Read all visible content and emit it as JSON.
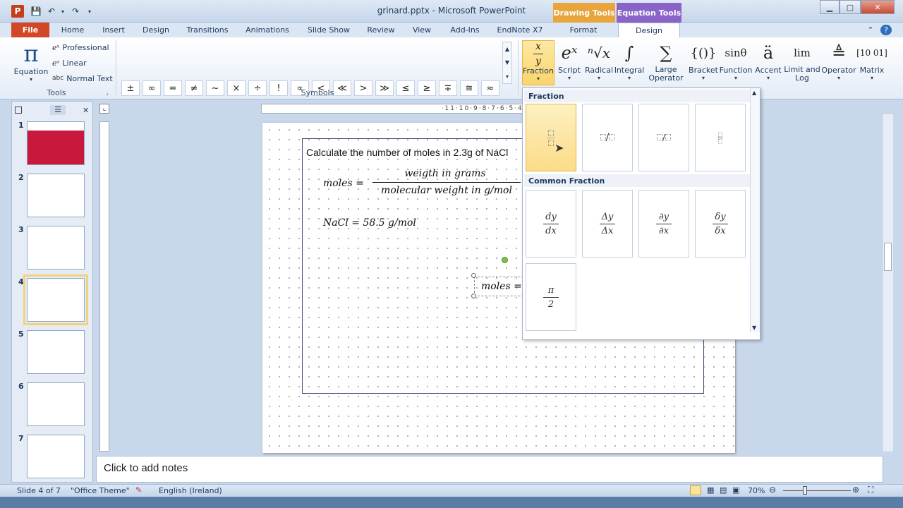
{
  "window": {
    "title": "grinard.pptx - Microsoft PowerPoint",
    "contextual_tabs": [
      "Drawing Tools",
      "Equation Tools"
    ]
  },
  "tabs": [
    "File",
    "Home",
    "Insert",
    "Design",
    "Transitions",
    "Animations",
    "Slide Show",
    "Review",
    "View",
    "Add-Ins",
    "EndNote X7",
    "Format",
    "Design"
  ],
  "ribbon": {
    "tools_group": {
      "label": "Tools",
      "equation": "Equation",
      "professional": "Professional",
      "linear": "Linear",
      "normal_text": "Normal Text"
    },
    "symbols_group": {
      "label": "Symbols",
      "row1": [
        "±",
        "∞",
        "=",
        "≠",
        "~",
        "×",
        "÷",
        "!",
        "∝",
        "<",
        "≪",
        ">",
        "≫",
        "≤",
        "≥",
        "∓",
        "≅",
        "≈"
      ],
      "row2": [
        "≡",
        "∀",
        "∁",
        "∂",
        "√",
        "∛",
        "∜",
        "∪",
        "∩",
        "∅",
        "%",
        "∘",
        "℉",
        "℃",
        "∆",
        "∇",
        "∃",
        "∄"
      ]
    },
    "structures": [
      {
        "label": "Fraction",
        "glyph": "x/y"
      },
      {
        "label": "Script",
        "glyph": "eˣ"
      },
      {
        "label": "Radical",
        "glyph": "ⁿ√x"
      },
      {
        "label": "Integral",
        "glyph": "∫"
      },
      {
        "label": "Large Operator",
        "glyph": "∑"
      },
      {
        "label": "Bracket",
        "glyph": "{()}"
      },
      {
        "label": "Function",
        "glyph": "sinθ"
      },
      {
        "label": "Accent",
        "glyph": "ä"
      },
      {
        "label": "Limit and Log",
        "glyph": "lim"
      },
      {
        "label": "Operator",
        "glyph": "≜"
      },
      {
        "label": "Matrix",
        "glyph": "[10 01]"
      }
    ]
  },
  "gallery": {
    "fraction_header": "Fraction",
    "common_header": "Common Fraction",
    "common_items": [
      {
        "num": "dy",
        "den": "dx"
      },
      {
        "num": "Δy",
        "den": "Δx"
      },
      {
        "num": "∂y",
        "den": "∂x"
      },
      {
        "num": "δy",
        "den": "δx"
      },
      {
        "num": "π",
        "den": "2"
      }
    ]
  },
  "slides": [
    1,
    2,
    3,
    4,
    5,
    6,
    7
  ],
  "slide": {
    "text": "Calculate the number of moles in 2.3g of NaCl",
    "eq_lhs": "moles =",
    "eq_num": "weigth in grams",
    "eq_den": "molecular weight in  g/mol",
    "nacl": "NaCl = 58.5  g/mol",
    "active_eq": "moles ="
  },
  "notes_placeholder": "Click to add notes",
  "status": {
    "slide": "Slide 4 of 7",
    "theme": "\"Office Theme\"",
    "language": "English (Ireland)",
    "zoom": "70%"
  },
  "colors": {
    "file_tab": "#d24726",
    "drawing_tools": "#f0a030",
    "equation_tools": "#8460c8"
  }
}
